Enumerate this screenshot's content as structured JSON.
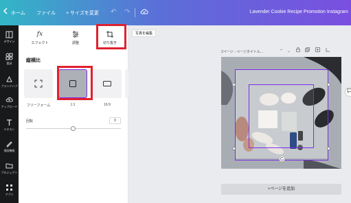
{
  "topbar": {
    "back_icon": "chevron-left-icon",
    "home": "ホーム",
    "file": "ファイル",
    "resize": "サイズを変更",
    "resize_prefix": "+",
    "doc_title": "Lavender Cookie Recipe Promotion Instagram",
    "undo_icon": "↶",
    "redo_icon": "↷",
    "cloud_icon": "cloud-save-icon"
  },
  "rail": {
    "items": [
      {
        "label": "デザイン",
        "icon": "layout-icon"
      },
      {
        "label": "素材",
        "icon": "shapes-icon"
      },
      {
        "label": "ブランドハブ",
        "icon": "brand-icon"
      },
      {
        "label": "アップロード",
        "icon": "upload-icon"
      },
      {
        "label": "テキスト",
        "icon": "text-icon"
      },
      {
        "label": "描画機能",
        "icon": "draw-icon"
      },
      {
        "label": "プロジェクト",
        "icon": "folder-icon"
      },
      {
        "label": "アプリ",
        "icon": "apps-icon"
      }
    ]
  },
  "panel": {
    "tabs": {
      "effects": {
        "label": "エフェクト",
        "icon": "fx"
      },
      "adjust": {
        "label": "調整"
      },
      "crop": {
        "label": "切り抜き"
      }
    },
    "aspect_title": "縦横比",
    "ratios": [
      {
        "label": "フリーフォーム"
      },
      {
        "label": "1:1"
      },
      {
        "label": "16:9"
      }
    ],
    "rotation_label": "回転",
    "rotation_value": "0",
    "rotation_fraction": 0.5
  },
  "canvas": {
    "edit_photo": "写真を編集",
    "page_label": "2ページ - ページタイトル...",
    "add_page": "+ページを追加",
    "chevron_up": "⌃",
    "chevron_down": "⌄"
  },
  "colors": {
    "accent": "#7d2ae8",
    "highlight": "#e0202e",
    "rail_bg": "#18191b"
  }
}
